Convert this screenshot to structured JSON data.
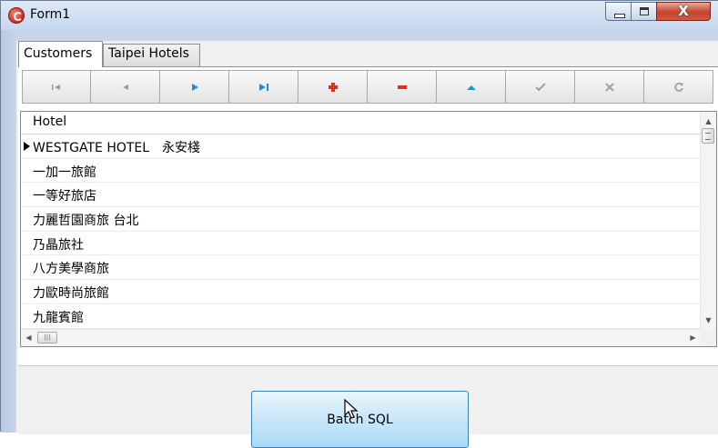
{
  "window": {
    "title": "Form1"
  },
  "tabs": [
    {
      "label": "Customers",
      "active": true
    },
    {
      "label": "Taipei Hotels",
      "active": false
    }
  ],
  "navigator": {
    "buttons": [
      {
        "name": "first-record-button",
        "icon": "first-icon",
        "enabled": false
      },
      {
        "name": "prior-record-button",
        "icon": "prior-icon",
        "enabled": false
      },
      {
        "name": "next-record-button",
        "icon": "next-icon",
        "enabled": true
      },
      {
        "name": "last-record-button",
        "icon": "last-icon",
        "enabled": true
      },
      {
        "name": "insert-record-button",
        "icon": "plus-icon",
        "enabled": true
      },
      {
        "name": "delete-record-button",
        "icon": "minus-icon",
        "enabled": true
      },
      {
        "name": "edit-record-button",
        "icon": "edit-icon",
        "enabled": true
      },
      {
        "name": "post-record-button",
        "icon": "check-icon",
        "enabled": false
      },
      {
        "name": "cancel-record-button",
        "icon": "cancel-icon",
        "enabled": false
      },
      {
        "name": "refresh-button",
        "icon": "refresh-icon",
        "enabled": false
      }
    ]
  },
  "grid": {
    "column_header": "Hotel",
    "rows": [
      "WESTGATE HOTEL　永安棧",
      "一加一旅館",
      "一等好旅店",
      "力麗哲園商旅 台北",
      "乃晶旅社",
      "八方美學商旅",
      "力歐時尚旅館",
      "九龍賓館"
    ],
    "current_row": 0
  },
  "batch_button": {
    "label": "Batch SQL"
  },
  "colors": {
    "nav_blue": "#1e8be6",
    "nav_red": "#e0301e",
    "nav_gray": "#9a9a9a"
  }
}
